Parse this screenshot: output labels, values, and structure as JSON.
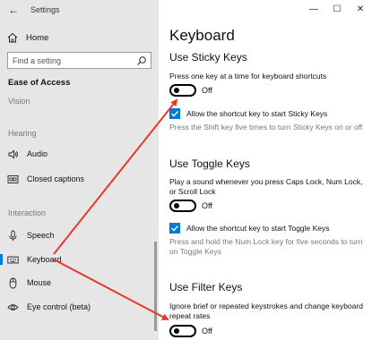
{
  "window": {
    "app_title": "Settings",
    "controls": {
      "minimize": "—",
      "maximize": "☐",
      "close": "✕"
    }
  },
  "sidebar": {
    "home_label": "Home",
    "search_placeholder": "Find a setting",
    "section_title": "Ease of Access",
    "groups": [
      {
        "label": "Vision"
      },
      {
        "label": "Hearing"
      },
      {
        "label": "Interaction"
      }
    ],
    "items": [
      {
        "label": "Audio",
        "icon": "speaker-icon"
      },
      {
        "label": "Closed captions",
        "icon": "closed-captions-icon"
      },
      {
        "label": "Speech",
        "icon": "microphone-icon"
      },
      {
        "label": "Keyboard",
        "icon": "keyboard-icon",
        "selected": true
      },
      {
        "label": "Mouse",
        "icon": "mouse-icon"
      },
      {
        "label": "Eye control (beta)",
        "icon": "eye-icon"
      }
    ]
  },
  "main": {
    "page_title": "Keyboard",
    "sticky": {
      "title": "Use Sticky Keys",
      "description": "Press one key at a time for keyboard shortcuts",
      "toggle_state": "Off",
      "checkbox_label": "Allow the shortcut key to start Sticky Keys",
      "note": "Press the Shift key five times to turn Sticky Keys on or off"
    },
    "toggle_keys": {
      "title": "Use Toggle Keys",
      "description": "Play a sound whenever you press Caps Lock, Num Lock, or Scroll Lock",
      "toggle_state": "Off",
      "checkbox_label": "Allow the shortcut key to start Toggle Keys",
      "note": "Press and hold the Num Lock key for five seconds to turn on Toggle Keys"
    },
    "filter": {
      "title": "Use Filter Keys",
      "description": "Ignore brief or repeated keystrokes and change keyboard repeat rates",
      "toggle_state": "Off"
    }
  },
  "annotation": {
    "arrow_color": "#e8372c"
  },
  "accent": "#0078d7"
}
